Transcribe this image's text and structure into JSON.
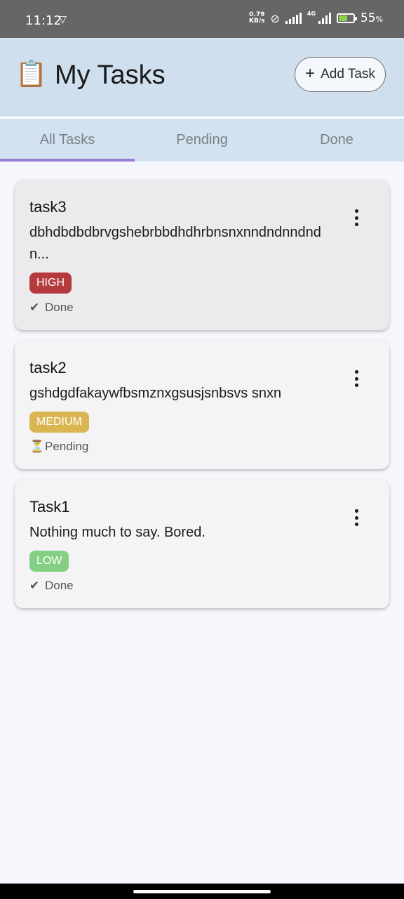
{
  "status_bar": {
    "time": "11:12",
    "net_speed_value": "0.79",
    "net_speed_unit": "KB/s",
    "network_type": "4G",
    "battery_percent": "55",
    "battery_symbol": "%"
  },
  "header": {
    "title_icon": "📋",
    "title": "My Tasks",
    "add_button_icon": "+",
    "add_button_label": "Add Task"
  },
  "tabs": [
    {
      "label": "All Tasks",
      "active": true
    },
    {
      "label": "Pending",
      "active": false
    },
    {
      "label": "Done",
      "active": false
    }
  ],
  "tasks": [
    {
      "title": "task3",
      "description": "dbhdbdbdbrvgshebrbbdhdhrbnsnxnndndnndndn...",
      "priority": "HIGH",
      "priority_color": "#b53a3e",
      "status_icon": "✔",
      "status": "Done"
    },
    {
      "title": "task2",
      "description": "gshdgdfakaywfbsmznxgsusjsnbsvs snxn",
      "priority": "MEDIUM",
      "priority_color": "#d9b651",
      "status_icon": "⏳",
      "status": "Pending"
    },
    {
      "title": "Task1",
      "description": "Nothing much to say. Bored.",
      "priority": "LOW",
      "priority_color": "#84cf83",
      "status_icon": "✔",
      "status": "Done"
    }
  ]
}
